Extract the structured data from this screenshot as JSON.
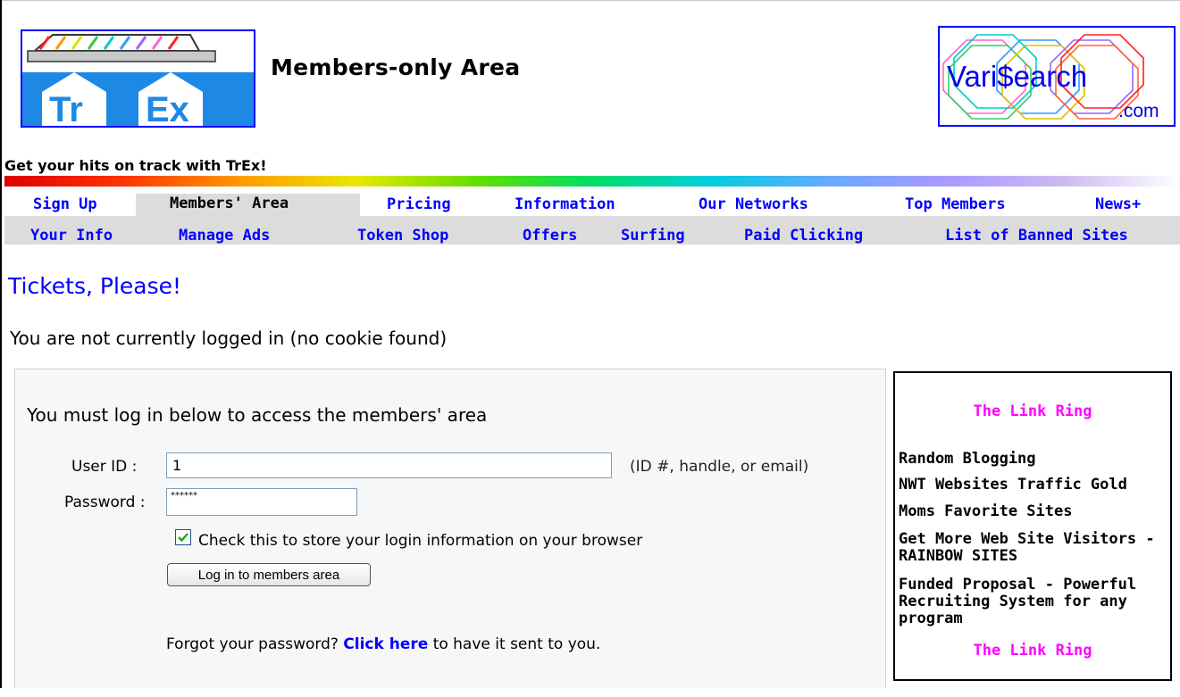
{
  "header": {
    "title": "Members-only Area",
    "trex_logo_text": [
      "Tr",
      "Ex"
    ],
    "varisearch_logo_text": [
      "Vari$earch",
      ".com"
    ],
    "tagline": "Get your hits on track with TrEx!"
  },
  "nav": {
    "row1": [
      "Sign Up",
      "Members' Area",
      "Pricing",
      "Information",
      "Our Networks",
      "Top Members",
      "News+"
    ],
    "row2": [
      "Your Info",
      "Manage Ads",
      "Token Shop",
      "Offers",
      "Surfing",
      "Paid Clicking",
      "List of Banned Sites"
    ],
    "active": "Members' Area"
  },
  "page": {
    "title": "Tickets, Please!",
    "status": "You are not currently logged in (no cookie found)"
  },
  "login": {
    "heading": "You must log in below to access the members' area",
    "userid_label": "User ID :",
    "userid_value": "1",
    "userid_hint": "(ID #, handle, or email)",
    "password_label": "Password :",
    "password_value": "******",
    "remember_checked": true,
    "remember_label": "Check this to store your login information on your browser",
    "button_label": "Log in to members area",
    "forgot_prefix": "Forgot your password?",
    "forgot_link": "Click here",
    "forgot_suffix": "to have it sent to you."
  },
  "link_ring": {
    "title": "The Link Ring",
    "links": [
      "Random Blogging",
      "NWT Websites Traffic Gold",
      "Moms Favorite Sites",
      "Get More Web Site Visitors - RAINBOW SITES",
      "Funded Proposal - Powerful Recruiting System for any program"
    ],
    "footer": "The Link Ring"
  },
  "colors": {
    "link": "#0000ff",
    "ring_title": "#ff00ff",
    "nav_bar": "#dcdcdc"
  }
}
